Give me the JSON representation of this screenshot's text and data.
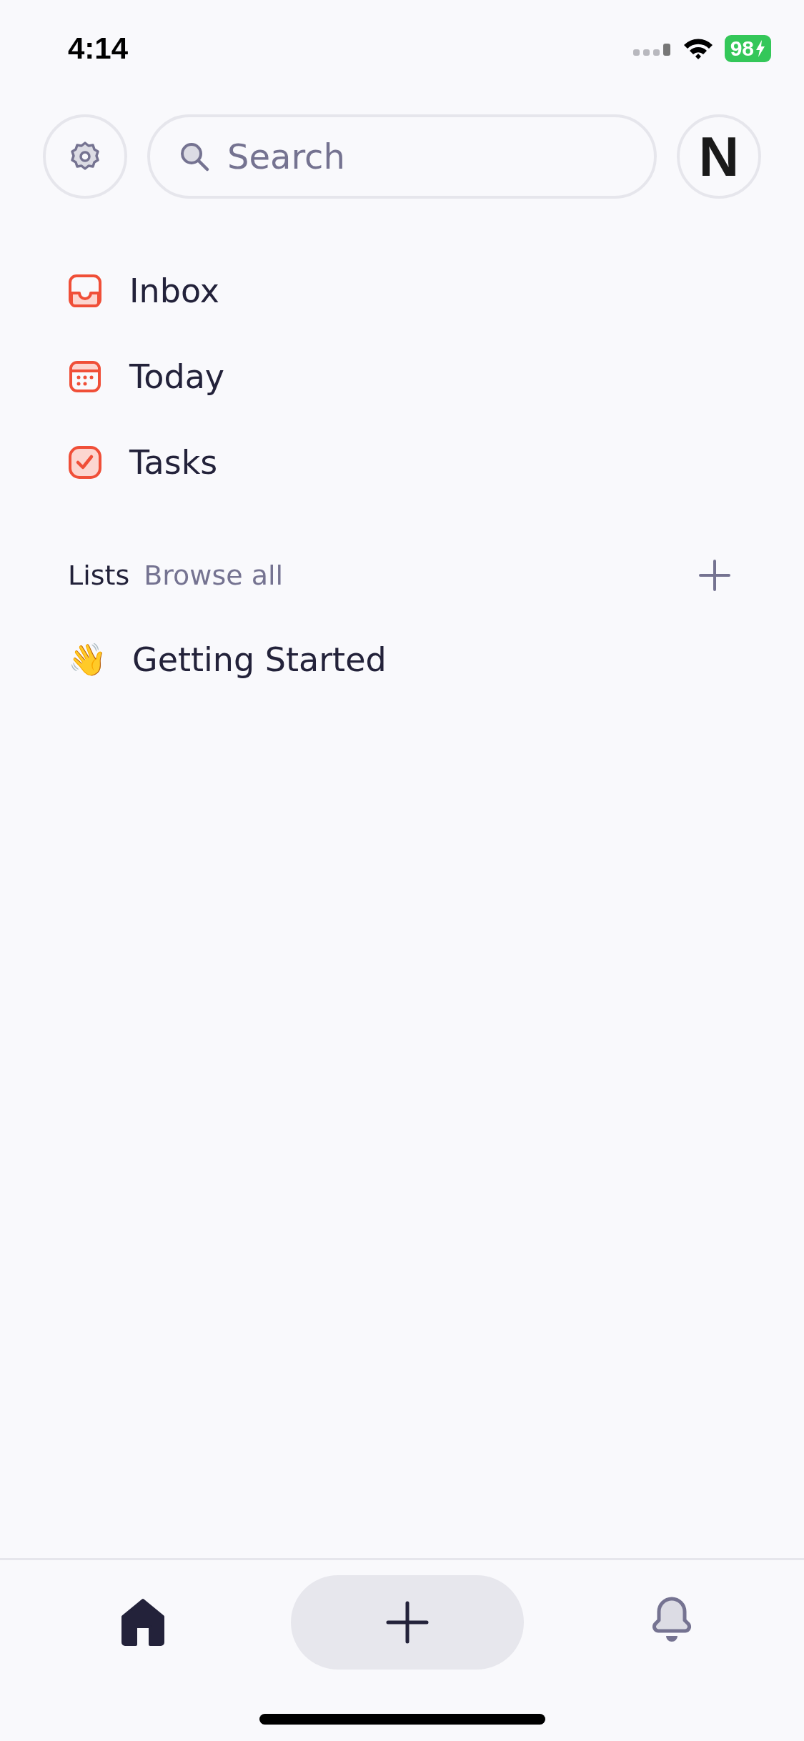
{
  "status_bar": {
    "time": "4:14",
    "battery": "98"
  },
  "header": {
    "search": {
      "placeholder": "Search"
    },
    "avatar": "N"
  },
  "nav": [
    {
      "label": "Inbox",
      "kind": "inbox"
    },
    {
      "label": "Today",
      "kind": "today"
    },
    {
      "label": "Tasks",
      "kind": "tasks"
    }
  ],
  "lists": {
    "title": "Lists",
    "browse": "Browse all",
    "items": [
      {
        "emoji": "👋",
        "label": "Getting Started"
      }
    ]
  },
  "tab_bar": [
    {
      "kind": "home",
      "selected": true
    },
    {
      "kind": "add"
    },
    {
      "kind": "bell",
      "selected": false
    }
  ]
}
